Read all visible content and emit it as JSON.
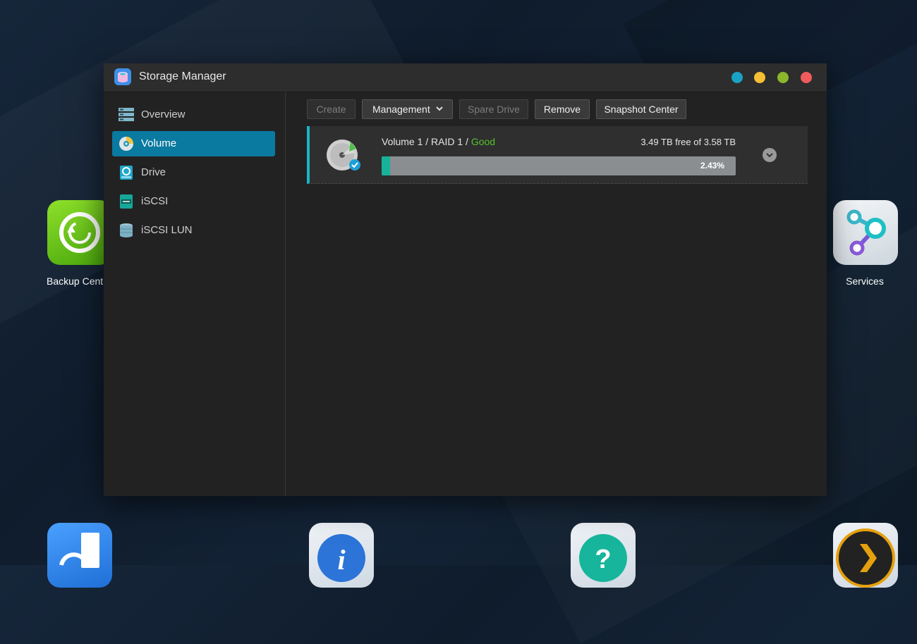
{
  "desktop": {
    "icons": [
      {
        "label": "Backup Cent"
      },
      {
        "label": "Services"
      }
    ]
  },
  "window": {
    "title": "Storage Manager",
    "controls": {
      "colors": [
        "#1aa2c4",
        "#f5c033",
        "#8ab72c",
        "#f25b5b"
      ]
    }
  },
  "sidebar": {
    "items": [
      {
        "label": "Overview"
      },
      {
        "label": "Volume",
        "active": true
      },
      {
        "label": "Drive"
      },
      {
        "label": "iSCSI"
      },
      {
        "label": "iSCSI LUN"
      }
    ]
  },
  "toolbar": {
    "create": "Create",
    "management": "Management",
    "spare_drive": "Spare Drive",
    "remove": "Remove",
    "snapshot_center": "Snapshot Center"
  },
  "volume": {
    "name": "Volume 1 / RAID 1 / ",
    "status": "Good",
    "free": "3.49 TB free of 3.58 TB",
    "usage_percent": 2.43,
    "usage_label": "2.43%"
  },
  "colors": {
    "accent": "#0b7aa0",
    "good": "#56c02b",
    "bar_fill": "#16b39a"
  }
}
